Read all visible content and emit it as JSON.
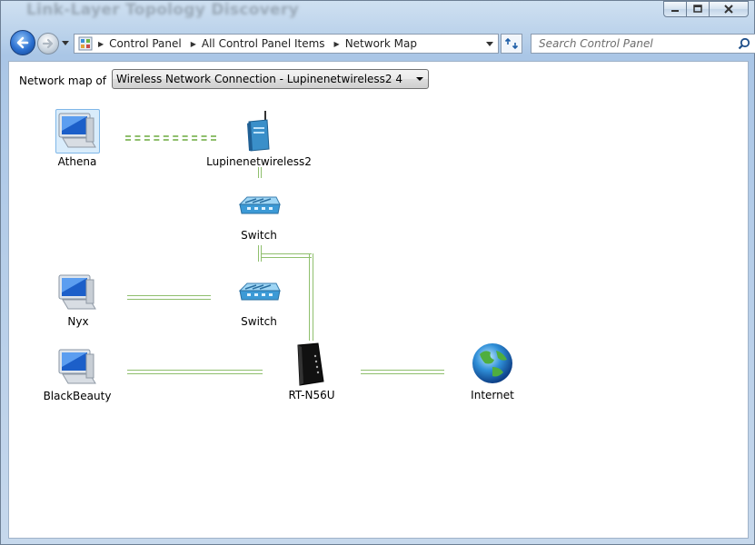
{
  "window": {
    "title": "Link-Layer Topology Discovery",
    "controls": {
      "minimize": "minimize",
      "maximize": "maximize",
      "close": "close"
    }
  },
  "navigation": {
    "breadcrumbs": [
      "Control Panel",
      "All Control Panel Items",
      "Network Map"
    ],
    "search_placeholder": "Search Control Panel"
  },
  "toolbar": {
    "map_label": "Network map of",
    "selected_network": "Wireless Network Connection - Lupinenetwireless2  4"
  },
  "map": {
    "nodes": {
      "athena": "Athena",
      "ap": "Lupinenetwireless2",
      "switch1": "Switch",
      "nyx": "Nyx",
      "switch2": "Switch",
      "blackbeauty": "BlackBeauty",
      "router": "RT-N56U",
      "internet": "Internet"
    }
  },
  "colors": {
    "link_line": "#8fbf6d",
    "selected_node_bg": "#d9ecfb",
    "frame_blue": "#b9d1ea"
  },
  "icons": [
    "back-arrow-icon",
    "forward-arrow-icon",
    "control-panel-icon",
    "refresh-icon",
    "search-icon",
    "computer-icon",
    "wireless-access-point-icon",
    "switch-icon",
    "router-icon",
    "globe-icon"
  ]
}
